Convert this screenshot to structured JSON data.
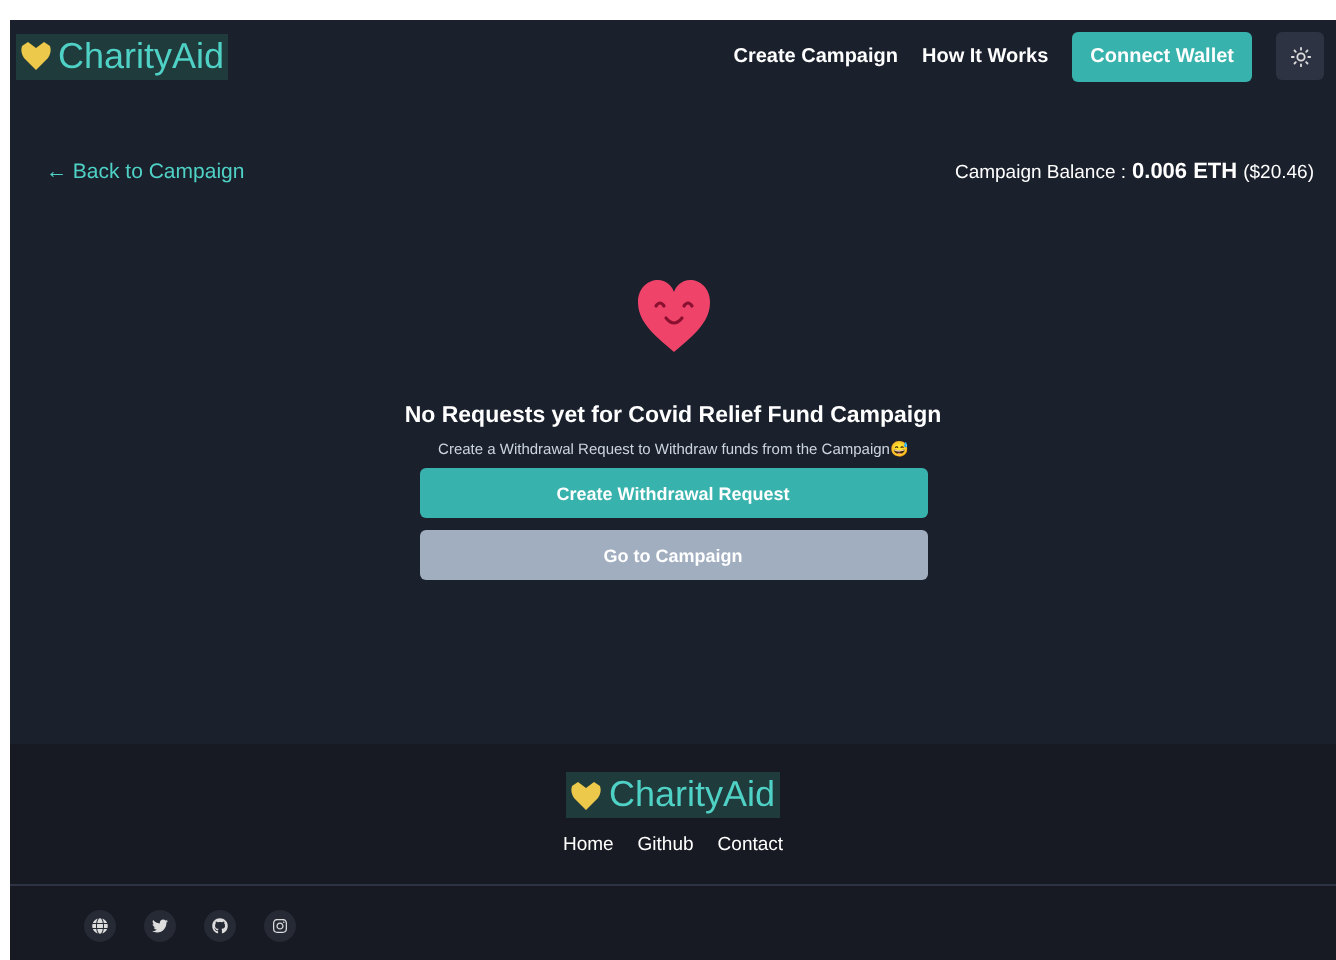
{
  "header": {
    "logo": "CharityAid",
    "nav": [
      "Create Campaign",
      "How It Works"
    ],
    "connect_button": "Connect Wallet"
  },
  "subheader": {
    "back_link": "← Back to Campaign",
    "balance_label": "Campaign Balance :",
    "balance_eth": "0.006 ETH",
    "balance_usd": "($20.46)"
  },
  "empty_state": {
    "title": "No Requests yet for Covid Relief Fund Campaign",
    "subtitle": "Create a Withdrawal Request to Withdraw funds from the Campaign😅",
    "primary_button": "Create Withdrawal Request",
    "secondary_button": "Go to Campaign"
  },
  "footer": {
    "logo": "CharityAid",
    "links": [
      "Home",
      "Github",
      "Contact"
    ]
  }
}
